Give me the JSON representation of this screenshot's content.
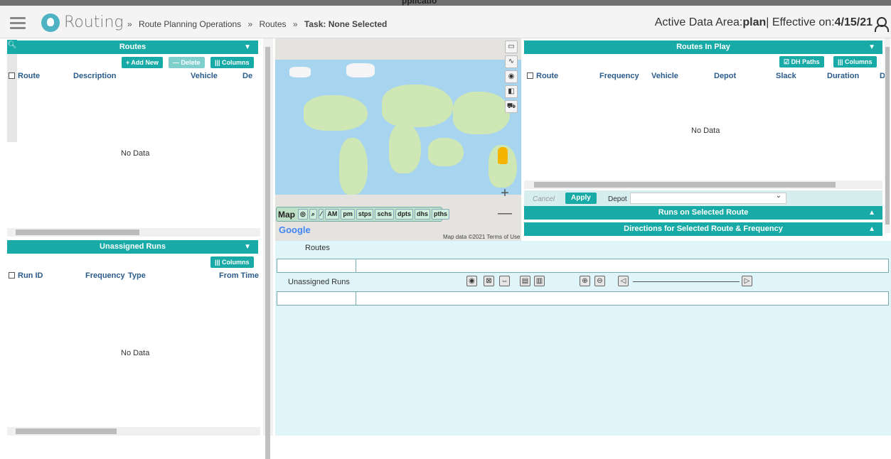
{
  "window_title_fragment": "pplicatio",
  "header": {
    "app_name": "Routing",
    "breadcrumb": [
      "Route Planning Operations",
      "Routes"
    ],
    "task_label": "Task: None Selected",
    "active_area_prefix": "Active Data Area:",
    "active_area_value": "plan",
    "effective_prefix": "| Effective on:",
    "effective_value": "4/15/21"
  },
  "routes_panel": {
    "title": "Routes",
    "buttons": {
      "add": "+ Add New",
      "delete": "— Delete",
      "columns": "||| Columns"
    },
    "columns": [
      "Route",
      "Description",
      "Vehicle",
      "De"
    ],
    "empty_text": "No Data"
  },
  "unassigned_panel": {
    "title": "Unassigned Runs",
    "buttons": {
      "columns": "||| Columns"
    },
    "columns": [
      "Run ID",
      "Frequency",
      "Type",
      "From Time"
    ],
    "empty_text": "No Data"
  },
  "routes_in_play": {
    "title": "Routes In Play",
    "buttons": {
      "dh_paths": "☑ DH Paths",
      "columns": "||| Columns"
    },
    "columns": [
      "Route",
      "Frequency",
      "Vehicle",
      "Depot",
      "Slack",
      "Duration",
      "D"
    ],
    "empty_text": "No Data",
    "filter": {
      "cancel": "Cancel",
      "apply": "Apply",
      "depot_label": "Depot"
    }
  },
  "collapsed_panels": [
    "Runs on Selected Route",
    "Directions for Selected Route & Frequency"
  ],
  "map": {
    "toolbar_label": "Map",
    "toolbar_buttons": [
      "AM",
      "pm",
      "stps",
      "schs",
      "dpts",
      "dhs",
      "pths"
    ],
    "attribution": "Map data ©2021   Terms of Use",
    "provider": "Google",
    "zoom_in": "+",
    "zoom_out": "—"
  },
  "gantt": {
    "routes_label": "Routes",
    "unassigned_label": "Unassigned Runs"
  },
  "colors": {
    "teal": "#17aaa6",
    "light_teal": "#e0f5f9"
  }
}
